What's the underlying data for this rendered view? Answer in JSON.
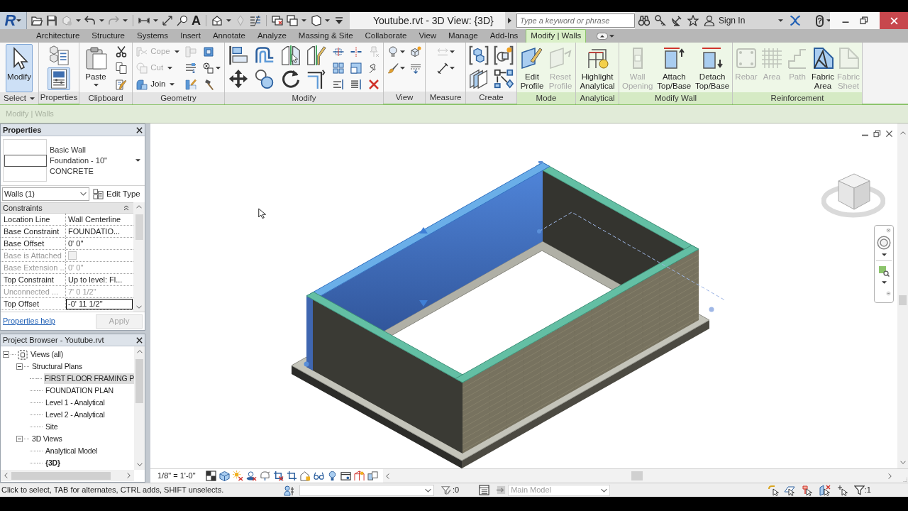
{
  "app_menu": {
    "logo": "R"
  },
  "quick_access": {
    "text_tool_glyph": "A"
  },
  "window": {
    "title": "Youtube.rvt - 3D View: {3D}"
  },
  "infocenter": {
    "search": {
      "placeholder": "Type a keyword or phrase"
    },
    "sign_in": "Sign In",
    "help_glyph": "?"
  },
  "ribbon_tabs": [
    {
      "label": "Architecture",
      "selected": false
    },
    {
      "label": "Structure",
      "selected": false
    },
    {
      "label": "Systems",
      "selected": false
    },
    {
      "label": "Insert",
      "selected": false
    },
    {
      "label": "Annotate",
      "selected": false
    },
    {
      "label": "Analyze",
      "selected": false
    },
    {
      "label": "Massing & Site",
      "selected": false
    },
    {
      "label": "Collaborate",
      "selected": false
    },
    {
      "label": "View",
      "selected": false
    },
    {
      "label": "Manage",
      "selected": false
    },
    {
      "label": "Add-Ins",
      "selected": false
    },
    {
      "label": "Modify | Walls",
      "selected": true
    }
  ],
  "ribbon_panels": [
    {
      "title": "Select",
      "title_dropdown": true,
      "contextual": false,
      "columns": [
        [
          {
            "kind": "large",
            "label": "Modify",
            "disabled": false,
            "active": true
          }
        ]
      ]
    },
    {
      "title": "Properties",
      "contextual": false,
      "columns": [
        [
          {
            "kind": "medium",
            "disabled": false,
            "active": false
          },
          {
            "kind": "medium",
            "disabled": false,
            "active": true
          }
        ]
      ]
    },
    {
      "title": "Clipboard",
      "contextual": false,
      "columns": [
        [
          {
            "kind": "large",
            "label": "Paste",
            "dropdown": true,
            "disabled": false,
            "active": false
          }
        ],
        [
          {
            "kind": "icon",
            "disabled": false,
            "active": false
          },
          {
            "kind": "icon",
            "disabled": false,
            "active": false
          },
          {
            "kind": "icon",
            "disabled": false,
            "active": false
          }
        ]
      ]
    },
    {
      "title": "Geometry",
      "contextual": false,
      "columns": [
        [
          {
            "kind": "small",
            "label": "Cope",
            "dropdown": true,
            "disabled": true,
            "active": false
          },
          {
            "kind": "small",
            "label": "Cut",
            "dropdown": true,
            "disabled": true,
            "active": false
          },
          {
            "kind": "small",
            "label": "Join",
            "dropdown": true,
            "disabled": false,
            "active": false
          }
        ],
        [
          {
            "kind": "icon",
            "disabled": true,
            "active": false
          },
          {
            "kind": "icon",
            "disabled": false,
            "active": false
          },
          {
            "kind": "icon",
            "disabled": false,
            "active": false
          }
        ],
        [
          {
            "kind": "icon",
            "disabled": false,
            "active": false
          },
          {
            "kind": "icon",
            "dropdown": true,
            "disabled": false,
            "active": false
          },
          {
            "kind": "icon",
            "disabled": false,
            "active": false
          }
        ]
      ]
    },
    {
      "title": "Modify",
      "contextual": false,
      "columns": [
        [
          {
            "kind": "medium",
            "disabled": false,
            "active": false
          },
          {
            "kind": "medium",
            "disabled": false,
            "active": false
          }
        ],
        [
          {
            "kind": "medium",
            "disabled": false,
            "active": false
          },
          {
            "kind": "medium",
            "disabled": false,
            "active": false
          }
        ],
        [
          {
            "kind": "medium",
            "disabled": false,
            "active": false
          },
          {
            "kind": "medium",
            "disabled": false,
            "active": false
          }
        ],
        [
          {
            "kind": "medium",
            "disabled": false,
            "active": false
          },
          {
            "kind": "medium",
            "disabled": false,
            "active": false
          }
        ],
        [
          {
            "kind": "icon",
            "disabled": false,
            "active": false
          },
          {
            "kind": "icon",
            "disabled": false,
            "active": false
          },
          {
            "kind": "icon",
            "disabled": false,
            "active": false
          }
        ],
        [
          {
            "kind": "icon",
            "disabled": false,
            "active": false
          },
          {
            "kind": "icon",
            "disabled": false,
            "active": false
          },
          {
            "kind": "icon",
            "disabled": false,
            "active": false
          }
        ],
        [
          {
            "kind": "icon",
            "disabled": true,
            "active": false
          },
          {
            "kind": "icon",
            "disabled": false,
            "active": false
          },
          {
            "kind": "icon",
            "disabled": false,
            "active": false
          }
        ]
      ]
    },
    {
      "title": "View",
      "contextual": false,
      "columns": [
        [
          {
            "kind": "icon",
            "dropdown": true,
            "disabled": false,
            "active": false
          },
          {
            "kind": "icon",
            "dropdown": true,
            "disabled": false,
            "active": false
          }
        ],
        [
          {
            "kind": "icon",
            "disabled": false,
            "active": false
          },
          {
            "kind": "icon",
            "disabled": false,
            "active": false
          }
        ]
      ]
    },
    {
      "title": "Measure",
      "contextual": false,
      "columns": [
        [
          {
            "kind": "icon",
            "dropdown": true,
            "disabled": true,
            "active": false
          },
          {
            "kind": "icon",
            "dropdown": true,
            "disabled": false,
            "active": false
          }
        ]
      ]
    },
    {
      "title": "Create",
      "contextual": false,
      "columns": [
        [
          {
            "kind": "medium",
            "disabled": false,
            "active": false
          },
          {
            "kind": "medium",
            "disabled": false,
            "active": false
          }
        ],
        [
          {
            "kind": "medium",
            "disabled": false,
            "active": false
          },
          {
            "kind": "medium",
            "disabled": false,
            "active": false
          }
        ]
      ]
    },
    {
      "title": "Mode",
      "contextual": true,
      "columns": [
        [
          {
            "kind": "large",
            "label": "Edit Profile",
            "disabled": false,
            "active": false
          }
        ],
        [
          {
            "kind": "large",
            "label": "Reset Profile",
            "disabled": true,
            "active": false
          }
        ]
      ]
    },
    {
      "title": "Analytical",
      "contextual": true,
      "columns": [
        [
          {
            "kind": "large",
            "label": "Highlight Analytical",
            "disabled": false,
            "active": false
          }
        ]
      ]
    },
    {
      "title": "Modify Wall",
      "contextual": true,
      "columns": [
        [
          {
            "kind": "large",
            "label": "Wall Opening",
            "disabled": true,
            "active": false
          }
        ],
        [
          {
            "kind": "large",
            "label": "Attach Top/Base",
            "disabled": false,
            "active": false
          }
        ],
        [
          {
            "kind": "large",
            "label": "Detach Top/Base",
            "disabled": false,
            "active": false
          }
        ]
      ]
    },
    {
      "title": "Reinforcement",
      "contextual": true,
      "columns": [
        [
          {
            "kind": "large",
            "label": "Rebar",
            "disabled": true,
            "active": false
          }
        ],
        [
          {
            "kind": "large",
            "label": "Area",
            "disabled": true,
            "active": false
          }
        ],
        [
          {
            "kind": "large",
            "label": "Path",
            "disabled": true,
            "active": false
          }
        ],
        [
          {
            "kind": "large",
            "label": "Fabric Area",
            "disabled": false,
            "active": false
          }
        ],
        [
          {
            "kind": "large",
            "label": "Fabric Sheet",
            "disabled": true,
            "active": false
          }
        ]
      ]
    }
  ],
  "context_bar": {
    "label": "Modify | Walls"
  },
  "properties": {
    "title": "Properties",
    "type_lines": [
      "Basic Wall",
      "Foundation - 10\"",
      "CONCRETE"
    ],
    "instance_filter": "Walls (1)",
    "edit_type": "Edit Type",
    "section": {
      "title": "Constraints",
      "expanded": true
    },
    "rows": [
      {
        "label": "Location Line",
        "kind": "text",
        "value": "Wall Centerline",
        "disabled": false
      },
      {
        "label": "Base Constraint",
        "kind": "text",
        "value": "FOUNDATIO...",
        "disabled": false
      },
      {
        "label": "Base Offset",
        "kind": "text",
        "value": "0' 0\"",
        "disabled": false
      },
      {
        "label": "Base is Attached",
        "kind": "checkbox",
        "checked": false,
        "disabled": true
      },
      {
        "label": "Base Extension ...",
        "kind": "text",
        "value": "0' 0\"",
        "disabled": true
      },
      {
        "label": "Top Constraint",
        "kind": "text",
        "value": "Up to level: Fl...",
        "disabled": false
      },
      {
        "label": "Unconnected ...",
        "kind": "text",
        "value": "7' 0 1/2\"",
        "disabled": true
      },
      {
        "label": "Top Offset",
        "kind": "input",
        "value": "-0' 11 1/2\"",
        "disabled": false
      }
    ],
    "help_link": "Properties help",
    "apply": {
      "label": "Apply",
      "disabled": true
    }
  },
  "project_browser": {
    "title": "Project Browser - Youtube.rvt",
    "tree": [
      {
        "label": "Views (all)",
        "expanded": true,
        "selected": false,
        "current": false,
        "children": [
          {
            "label": "Structural Plans",
            "expanded": true,
            "selected": false,
            "current": false,
            "children": [
              {
                "label": "FIRST FLOOR FRAMING P",
                "selected": true,
                "current": false
              },
              {
                "label": "FOUNDATION PLAN",
                "selected": false,
                "current": false
              },
              {
                "label": "Level 1 - Analytical",
                "selected": false,
                "current": false
              },
              {
                "label": "Level 2 - Analytical",
                "selected": false,
                "current": false
              },
              {
                "label": "Site",
                "selected": false,
                "current": false
              }
            ]
          },
          {
            "label": "3D Views",
            "expanded": true,
            "selected": false,
            "current": false,
            "children": [
              {
                "label": "Analytical Model",
                "selected": false,
                "current": false
              },
              {
                "label": "{3D}",
                "selected": false,
                "current": true
              }
            ]
          }
        ]
      }
    ]
  },
  "view": {
    "scale": "1/8\" = 1'-0\""
  },
  "status_bar": {
    "message": "Click to select, TAB for alternates, CTRL adds, SHIFT unselects.",
    "indicator_count": ":0",
    "design_option": {
      "label": "Main Model",
      "disabled": true
    },
    "filter_count": ":1"
  }
}
